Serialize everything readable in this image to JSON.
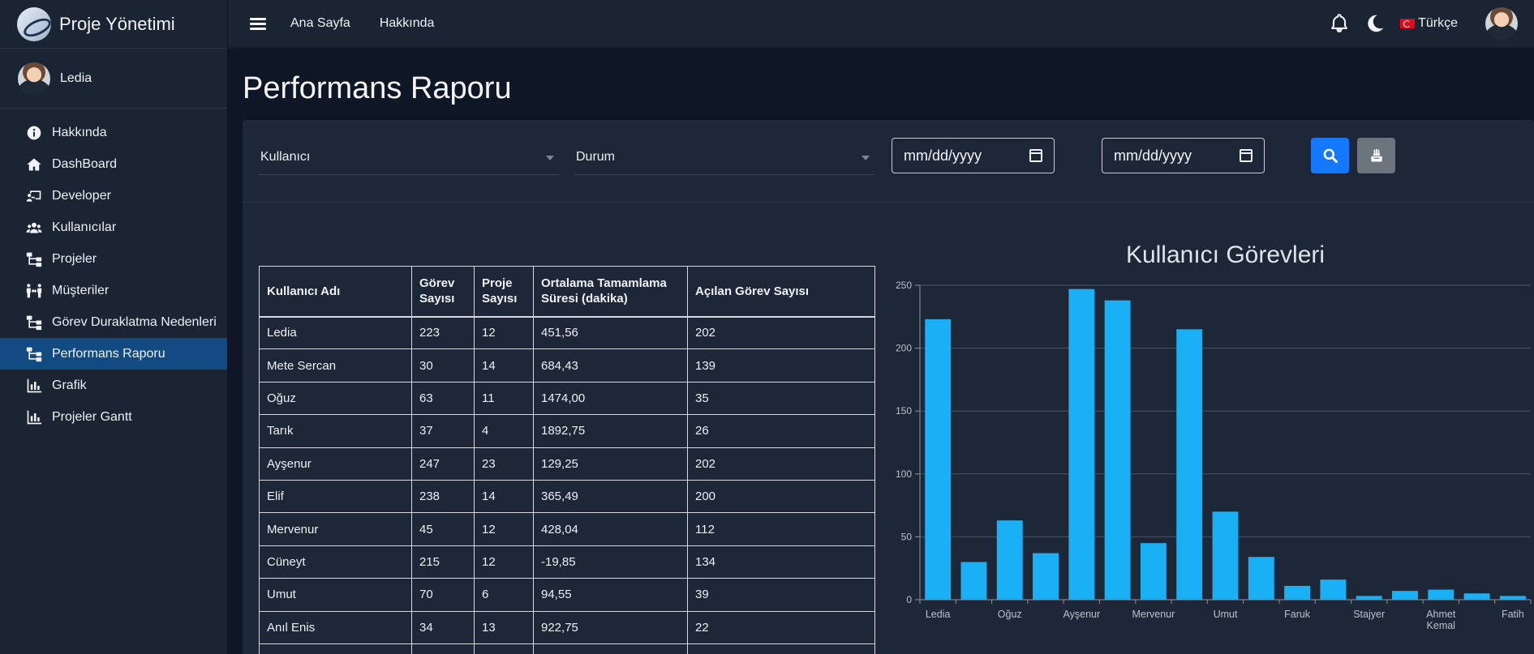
{
  "app": {
    "title": "Proje Yönetimi"
  },
  "user": {
    "name": "Ledia"
  },
  "sidebar": {
    "items": [
      {
        "label": "Hakkında",
        "icon": "info-icon"
      },
      {
        "label": "DashBoard",
        "icon": "home-icon"
      },
      {
        "label": "Developer",
        "icon": "chalkboard-icon"
      },
      {
        "label": "Kullanıcılar",
        "icon": "users-icon"
      },
      {
        "label": "Projeler",
        "icon": "sitemap-icon"
      },
      {
        "label": "Müşteriler",
        "icon": "people-arrows-icon"
      },
      {
        "label": "Görev Duraklatma Nedenleri",
        "icon": "sitemap-icon"
      },
      {
        "label": "Performans Raporu",
        "icon": "sitemap-icon",
        "active": true
      },
      {
        "label": "Grafik",
        "icon": "chart-icon"
      },
      {
        "label": "Projeler Gantt",
        "icon": "chart-icon"
      }
    ]
  },
  "topbar": {
    "home": "Ana Sayfa",
    "about": "Hakkında",
    "language": "Türkçe"
  },
  "page": {
    "title": "Performans Raporu"
  },
  "filters": {
    "user_placeholder": "Kullanıcı",
    "status_placeholder": "Durum",
    "date_start": "mm/dd/yyyy",
    "date_end": "mm/dd/yyyy"
  },
  "table": {
    "headers": [
      "Kullanıcı Adı",
      "Görev Sayısı",
      "Proje Sayısı",
      "Ortalama Tamamlama Süresi (dakika)",
      "Açılan Görev Sayısı"
    ],
    "rows": [
      [
        "Ledia",
        "223",
        "12",
        "451,56",
        "202"
      ],
      [
        "Mete Sercan",
        "30",
        "14",
        "684,43",
        "139"
      ],
      [
        "Oğuz",
        "63",
        "11",
        "1474,00",
        "35"
      ],
      [
        "Tarık",
        "37",
        "4",
        "1892,75",
        "26"
      ],
      [
        "Ayşenur",
        "247",
        "23",
        "129,25",
        "202"
      ],
      [
        "Elif",
        "238",
        "14",
        "365,49",
        "200"
      ],
      [
        "Mervenur",
        "45",
        "12",
        "428,04",
        "112"
      ],
      [
        "Cüneyt",
        "215",
        "12",
        "-19,85",
        "134"
      ],
      [
        "Umut",
        "70",
        "6",
        "94,55",
        "39"
      ],
      [
        "Anıl Enis",
        "34",
        "13",
        "922,75",
        "22"
      ],
      [
        "",
        "",
        "",
        "",
        ""
      ]
    ]
  },
  "colors": {
    "bar": "#1ab0f5",
    "active_nav": "#124b82",
    "search_button": "#1479ff"
  },
  "chart_data": {
    "type": "bar",
    "title": "Kullanıcı Görevleri",
    "categories": [
      "Ledia",
      "Mete Sercan",
      "Oğuz",
      "Tarık",
      "Ayşenur",
      "Elif",
      "Mervenur",
      "Cüneyt",
      "Umut",
      "Anıl Enis",
      "Faruk",
      "",
      "Stajyer",
      "",
      "Ahmet Kemal",
      "",
      "Fatih"
    ],
    "tick_labels": [
      "Ledia",
      "Oğuz",
      "Ayşenur",
      "Mervenur",
      "Umut",
      "Faruk",
      "Stajyer",
      "Ahmet Kemal",
      "Fatih"
    ],
    "tick_label_indices": [
      0,
      2,
      4,
      6,
      8,
      10,
      12,
      14,
      16
    ],
    "values": [
      223,
      30,
      63,
      37,
      247,
      238,
      45,
      215,
      70,
      34,
      11,
      16,
      3,
      7,
      8,
      5,
      3
    ],
    "ylim": [
      0,
      250
    ],
    "yticks": [
      0,
      50,
      100,
      150,
      200,
      250
    ],
    "grid": true
  }
}
